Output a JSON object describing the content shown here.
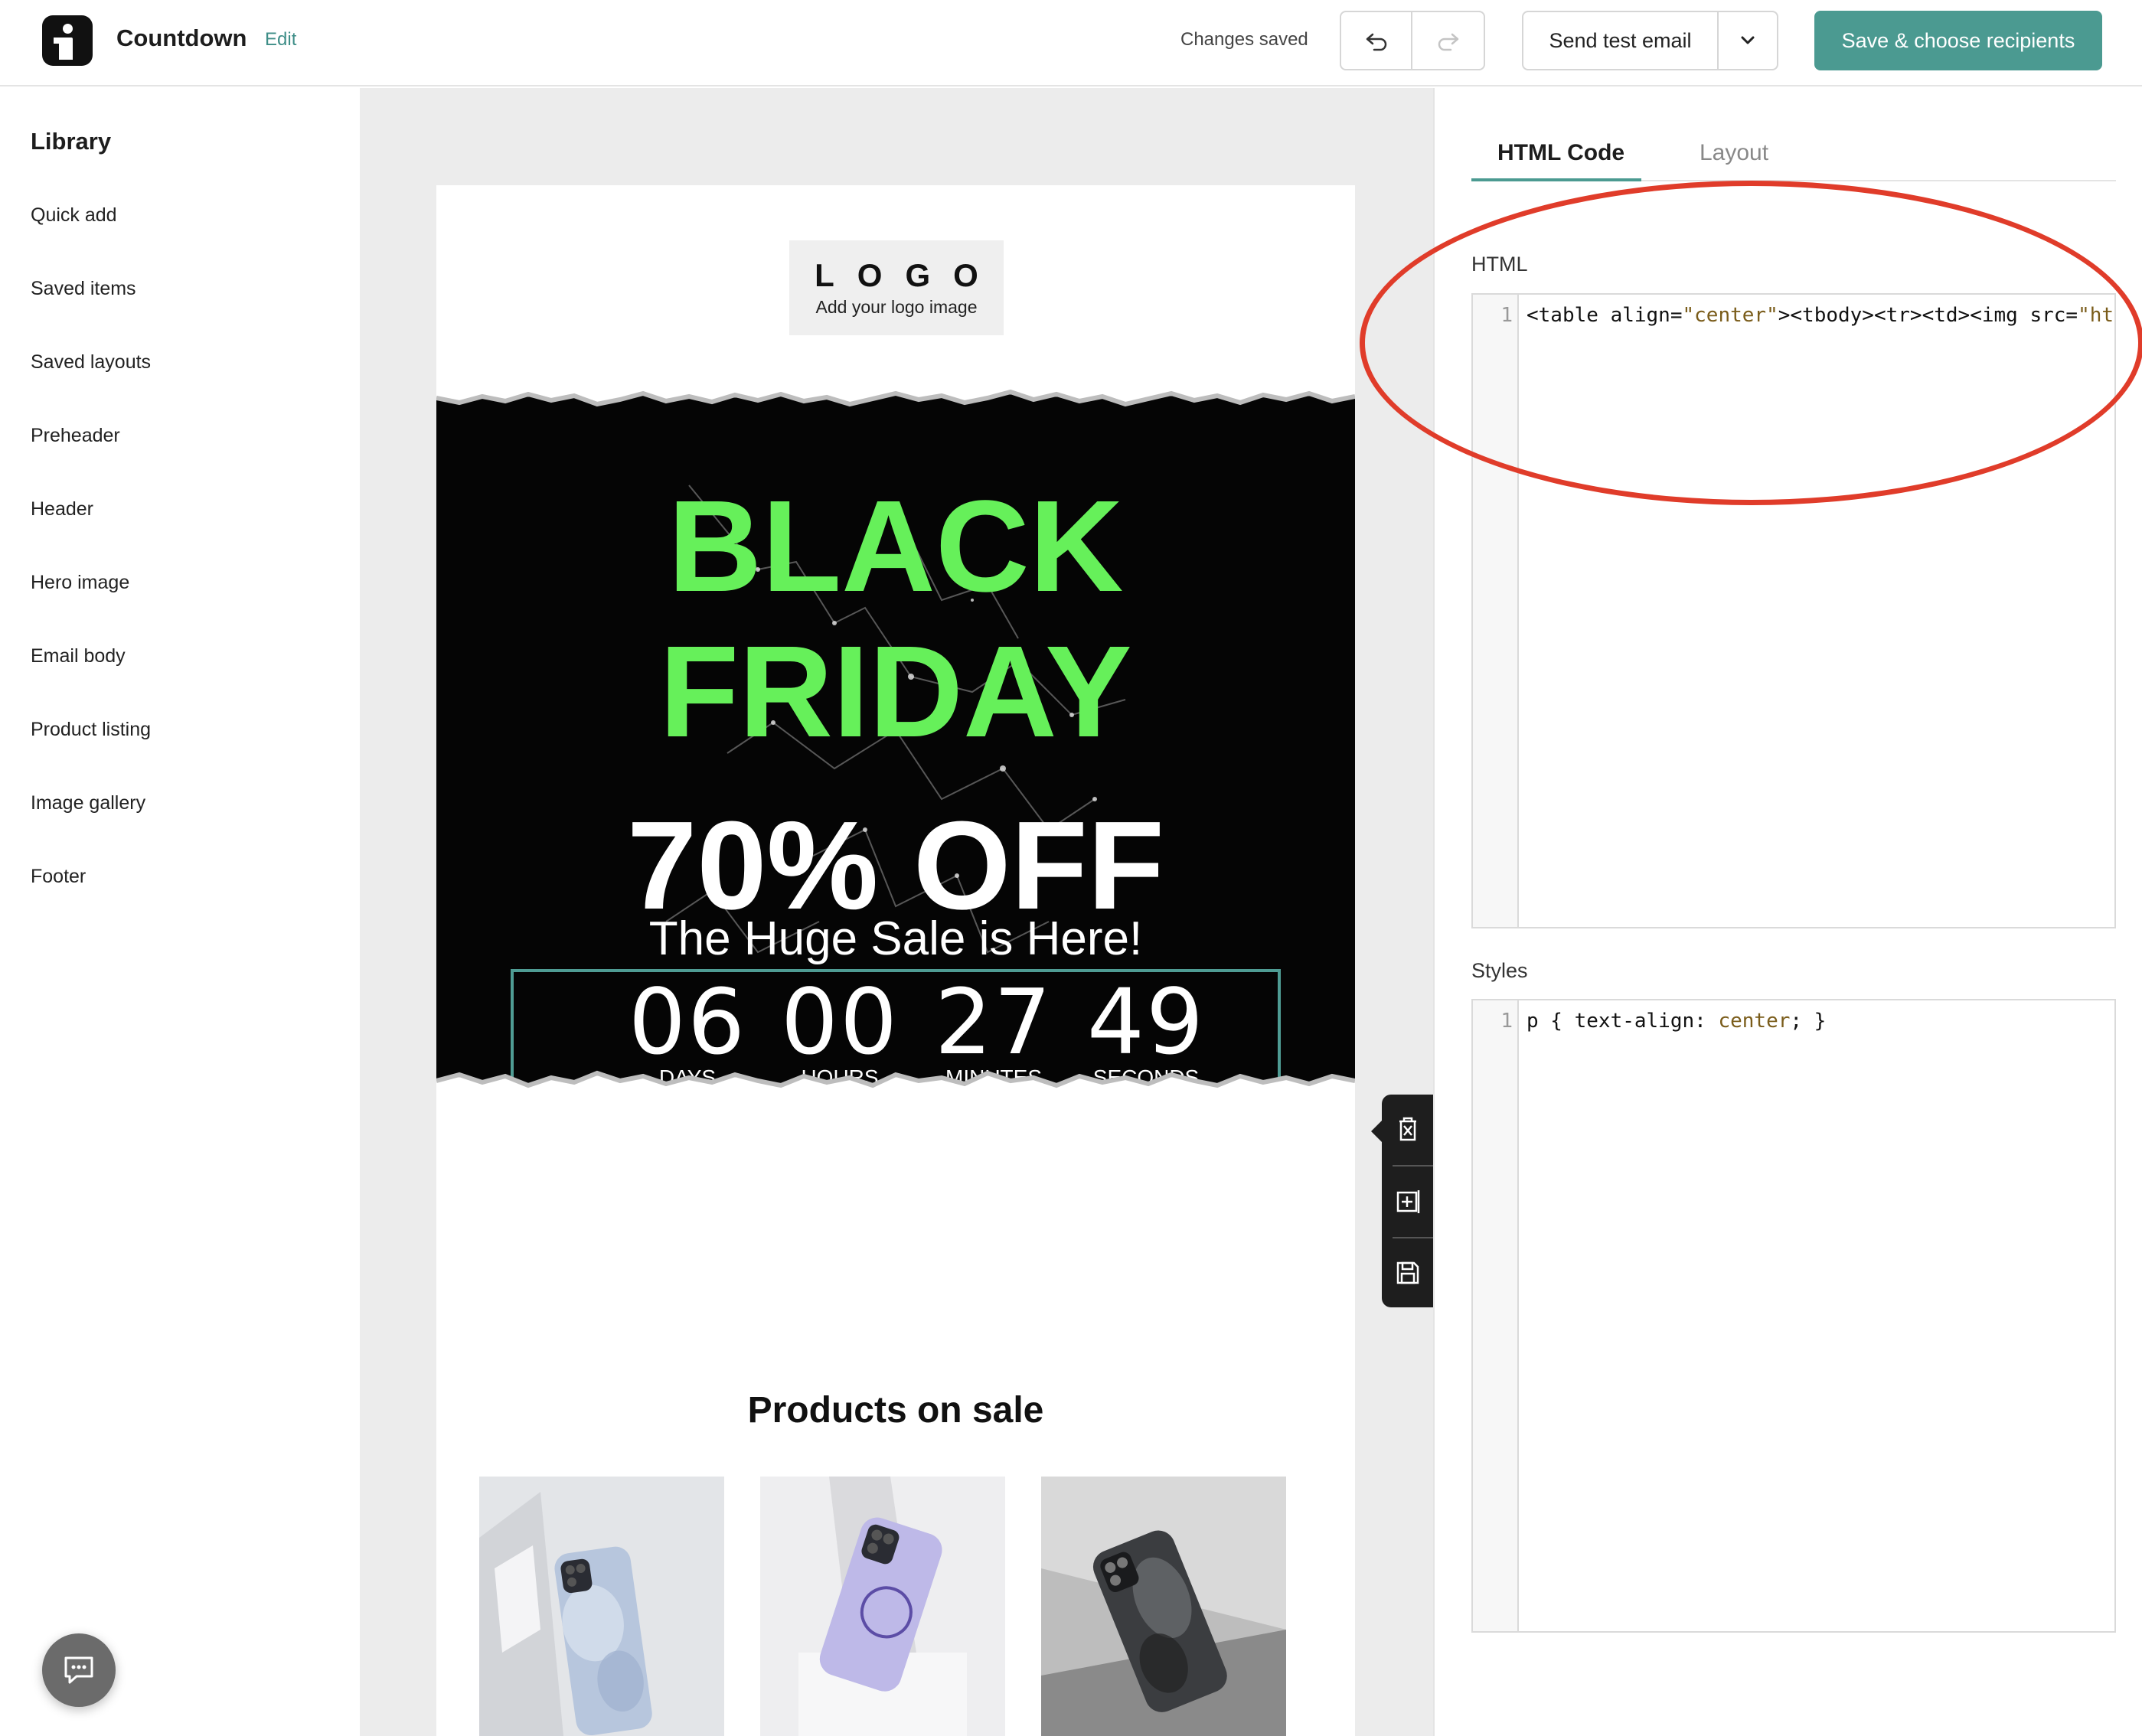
{
  "header": {
    "app_title": "Countdown",
    "edit_label": "Edit",
    "status": "Changes saved",
    "send_test_label": "Send test email",
    "save_label": "Save & choose recipients"
  },
  "library": {
    "title": "Library",
    "items": [
      "Quick add",
      "Saved items",
      "Saved layouts",
      "Preheader",
      "Header",
      "Hero image",
      "Email body",
      "Product listing",
      "Image gallery",
      "Footer"
    ]
  },
  "email": {
    "logo_text": "LOGO",
    "logo_sub": "Add your logo image",
    "hero_line1": "BLACK",
    "hero_line2": "FRIDAY",
    "discount": "70% OFF",
    "tagline": "The Huge Sale is Here!",
    "countdown": [
      {
        "value": "06",
        "label": "DAYS"
      },
      {
        "value": "00",
        "label": "HOURS"
      },
      {
        "value": "27",
        "label": "MINUTES"
      },
      {
        "value": "49",
        "label": "SECONDS"
      }
    ],
    "products_title": "Products on sale"
  },
  "panel": {
    "tabs": [
      "HTML Code",
      "Layout"
    ],
    "active_tab": "HTML Code",
    "html_label": "HTML",
    "html_line_number": "1",
    "html_code_prefix": "<table align=",
    "html_code_str1": "\"center\"",
    "html_code_mid": "><tbody><tr><td><img src=",
    "html_code_str2": "\"ht",
    "styles_label": "Styles",
    "styles_line_number": "1",
    "styles_code_prefix": "p { text-align: ",
    "styles_code_value": "center",
    "styles_code_suffix": "; }"
  },
  "colors": {
    "accent": "#4b9a91",
    "hero_green": "#66f05a",
    "annotation_red": "#e03c2a"
  },
  "icons": [
    "undo-icon",
    "redo-icon",
    "chevron-down-icon",
    "delete-block-icon",
    "duplicate-block-icon",
    "save-block-icon",
    "chat-icon"
  ]
}
